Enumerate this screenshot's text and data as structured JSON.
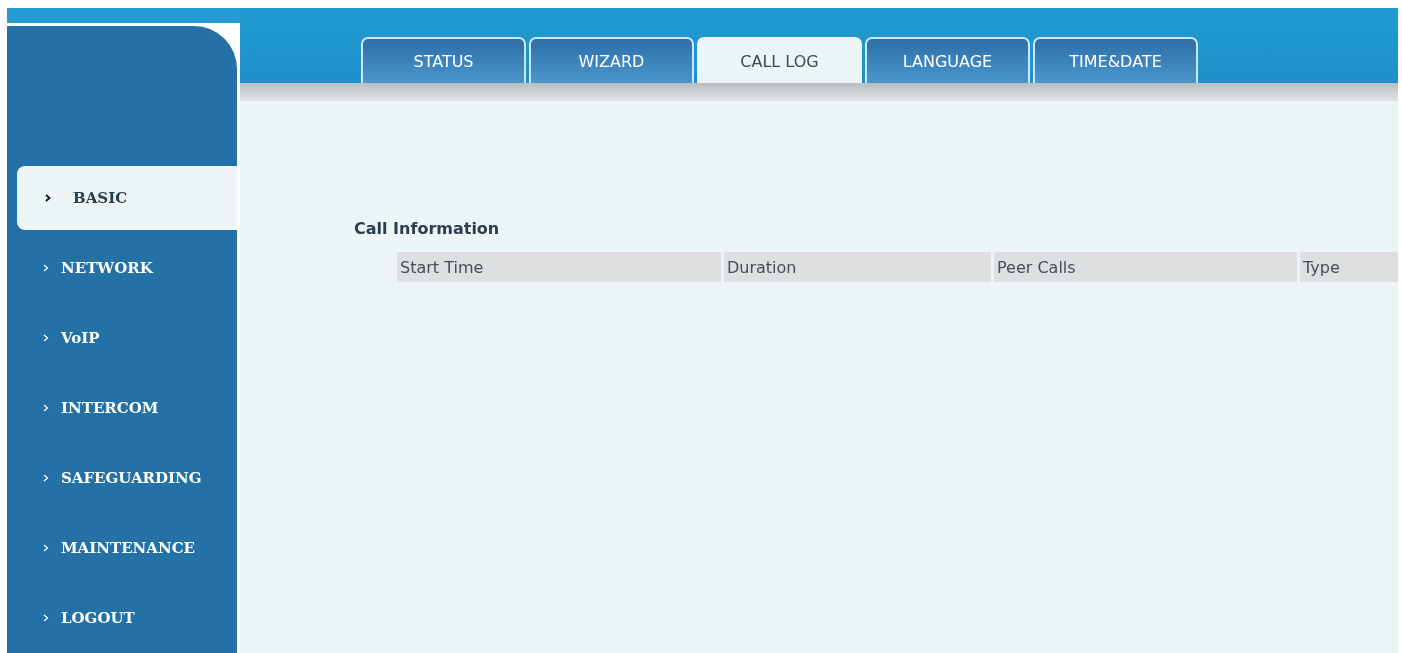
{
  "tabs": [
    {
      "label": "STATUS",
      "selected": false
    },
    {
      "label": "WIZARD",
      "selected": false
    },
    {
      "label": "CALL LOG",
      "selected": true
    },
    {
      "label": "LANGUAGE",
      "selected": false
    },
    {
      "label": "TIME&DATE",
      "selected": false
    }
  ],
  "sidebar": {
    "items": [
      {
        "label": "BASIC",
        "selected": true
      },
      {
        "label": "NETWORK",
        "selected": false
      },
      {
        "label": "VoIP",
        "selected": false
      },
      {
        "label": "INTERCOM",
        "selected": false
      },
      {
        "label": "SAFEGUARDING",
        "selected": false
      },
      {
        "label": "MAINTENANCE",
        "selected": false
      },
      {
        "label": "LOGOUT",
        "selected": false
      }
    ]
  },
  "call_information": {
    "title": "Call Information",
    "table": {
      "columns": [
        "Start Time",
        "Duration",
        "Peer Calls",
        "Type"
      ]
    }
  }
}
